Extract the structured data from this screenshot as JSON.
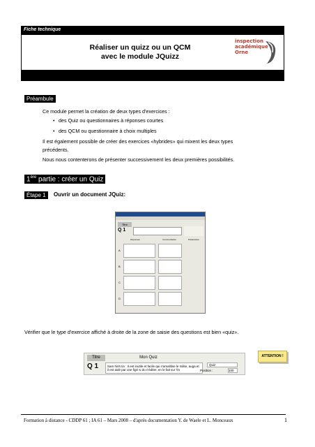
{
  "header": {
    "tag": "Fiche technique",
    "title_line1": "Réaliser un quizz ou un QCM",
    "title_line2": "avec le module JQuizz",
    "logo_lines": [
      "inspection",
      "académique",
      "Orne"
    ]
  },
  "preambule": {
    "label": "Préambule",
    "intro": "Ce module permet la création de deux types d'exercices :",
    "bullets": [
      "des Quiz ou questionnaires à réponses courtes",
      "des QCM ou questionnaire à choix multiples"
    ],
    "hybrid_line1": "Il est également possible de créer des exercices «hybrides» qui mixent les deux types",
    "hybrid_line2": "précédents.",
    "present": "Nous nous contenterons de présenter successivement les deux premières possibilités."
  },
  "part1": {
    "prefix": "1",
    "sup": "ère",
    "rest": " partie : créer un Quiz"
  },
  "etape1": {
    "label": "Étape 1",
    "title": "Ouvrir un document JQuiz:"
  },
  "app": {
    "tab": "Titre",
    "q_label": "Q 1",
    "col_reponses": "Réponses",
    "col_commentaires": "Commentaires",
    "col_parametres": "Paramètres",
    "rows": [
      "A",
      "B",
      "C",
      "D"
    ]
  },
  "verify": "Vérifier que le type d'exercice affiché à droite de la zone de saisie des questions est bien «quiz».",
  "strip": {
    "tab": "Titre",
    "title": "Mon Quiz",
    "q_label": "Q 1",
    "question_text": "Sam hinh tin : Il est inutile et facile qui n'amalitise le milite, auga et il est aidé par une figé si do n'éditer, en le fait sur l'in",
    "type_value": "Quiz",
    "position_label": "Position :",
    "position_value": "100"
  },
  "attention": "ATTENTION !",
  "footer": {
    "text": "Formation à distance - CDDP 61 ; IA 61 – Mars 2008 – d'après documentation Y. de Waele  et L. Monceaux",
    "page": "1"
  }
}
